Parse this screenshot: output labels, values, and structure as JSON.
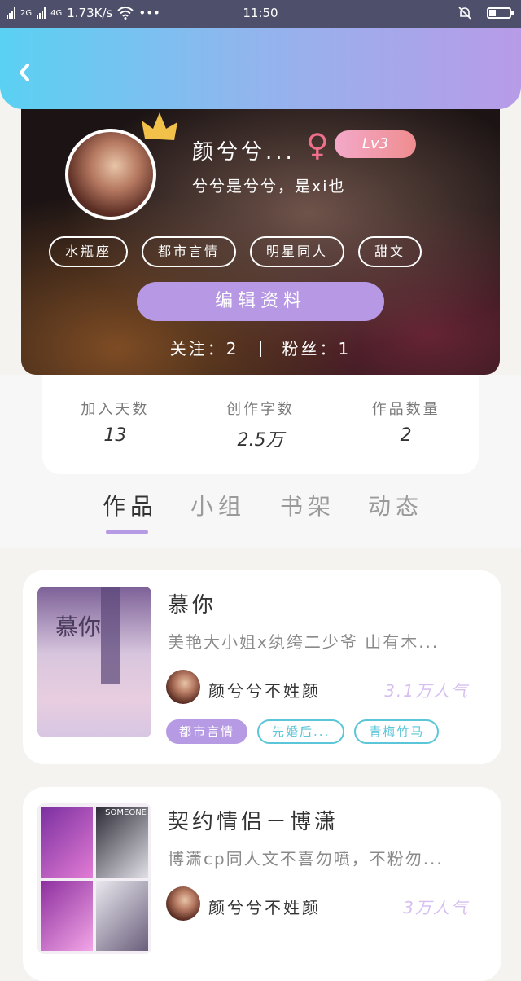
{
  "status_bar": {
    "net_left": "2G",
    "net_right": "4G",
    "speed": "1.73K/s",
    "dots": "•••",
    "time": "11:50"
  },
  "profile": {
    "name": "颜兮兮...",
    "gender_symbol": "♀",
    "level": "Lv3",
    "bio": "兮兮是兮兮，是xi也",
    "tags": [
      "水瓶座",
      "都市言情",
      "明星同人",
      "甜文"
    ],
    "edit_button": "编辑资料",
    "following_label": "关注：2",
    "followers_label": "粉丝：1"
  },
  "stats": [
    {
      "label": "加入天数",
      "value": "13"
    },
    {
      "label": "创作字数",
      "value": "2.5万"
    },
    {
      "label": "作品数量",
      "value": "2"
    }
  ],
  "tabs": [
    "作品",
    "小组",
    "书架",
    "动态"
  ],
  "active_tab": "作品",
  "works": [
    {
      "title": "慕你",
      "description": "美艳大小姐x纨绔二少爷 山有木...",
      "author": "颜兮兮不姓颜",
      "popularity": "3.1万人气",
      "tags": [
        "都市言情",
        "先婚后...",
        "青梅竹马"
      ],
      "cover_text": "慕你"
    },
    {
      "title": "契约情侣－博潇",
      "description": "博潇cp同人文不喜勿喷，不粉勿...",
      "author": "颜兮兮不姓颜",
      "popularity": "3万人气",
      "cover_text": "SOMEONE"
    }
  ],
  "colors": {
    "accent_purple": "#b79ae4",
    "accent_cyan": "#5ac6d8",
    "female_pink": "#f0708c"
  }
}
